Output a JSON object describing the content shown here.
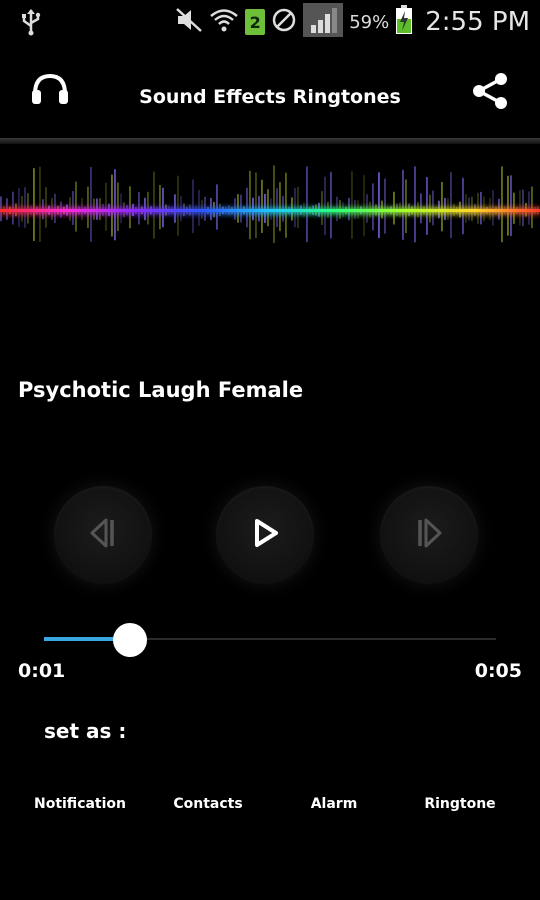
{
  "status_bar": {
    "battery_percent": "59%",
    "sim_slot": "2",
    "time": "2:55 PM",
    "icons": [
      "usb-icon",
      "mute-icon",
      "wifi-icon",
      "sim-icon",
      "block-icon",
      "signal-icon",
      "battery-charging-icon"
    ]
  },
  "app_bar": {
    "title": "Sound Effects Ringtones",
    "left_icon": "headphones-icon",
    "right_icon": "share-icon"
  },
  "player": {
    "song_title": "Psychotic Laugh Female",
    "current_time": "0:01",
    "total_time": "0:05",
    "progress": 0.19,
    "progress_color": "#3aa7e0",
    "controls": [
      "previous-icon",
      "play-icon",
      "next-icon"
    ]
  },
  "set_as": {
    "label": "set as :",
    "options": [
      "Notification",
      "Contacts",
      "Alarm",
      "Ringtone"
    ]
  }
}
